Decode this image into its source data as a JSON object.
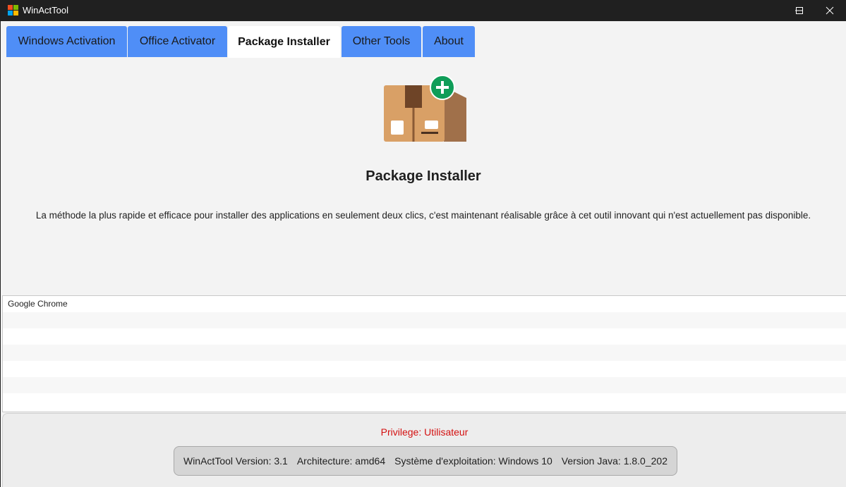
{
  "window": {
    "title": "WinActTool",
    "icon": "windows-logo-icon",
    "controls": [
      "minimize-icon",
      "maximize-icon",
      "close-icon"
    ]
  },
  "tabs": [
    {
      "label": "Windows Activation",
      "active": false
    },
    {
      "label": "Office Activator",
      "active": false
    },
    {
      "label": "Package Installer",
      "active": true
    },
    {
      "label": "Other Tools",
      "active": false
    },
    {
      "label": "About",
      "active": false
    }
  ],
  "main": {
    "icon": "package-box-plus-icon",
    "heading": "Package Installer",
    "description": "La méthode la plus rapide et efficace pour installer des applications en seulement deux clics, c'est maintenant réalisable grâce à cet outil innovant qui n'est actuellement pas disponible."
  },
  "package_list": {
    "items": [
      "Google Chrome"
    ]
  },
  "footer": {
    "privilege": "Privilege: Utilisateur",
    "version": "WinActTool Version: 3.1",
    "architecture": "Architecture: amd64",
    "os": "Système d'exploitation: Windows 10",
    "java": "Version Java: 1.8.0_202"
  },
  "colors": {
    "tab_inactive": "#4f8ef7",
    "tab_active": "#ffffff",
    "privilege_text": "#d41010",
    "titlebar": "#202020",
    "box_tan": "#d9a066",
    "box_dark": "#a0704a",
    "plus_badge": "#0f9d58"
  }
}
